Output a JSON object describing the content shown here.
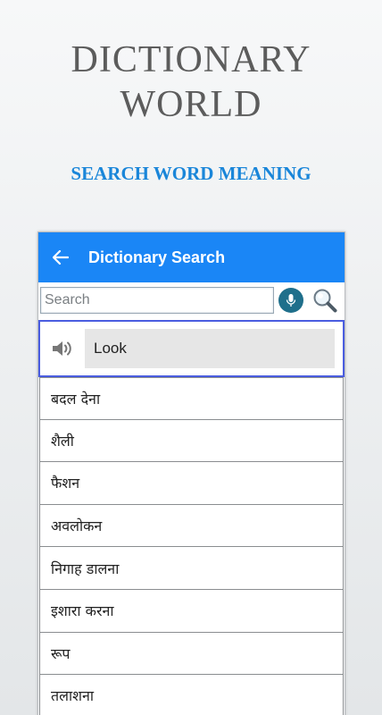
{
  "promo": {
    "title_line1": "DICTIONARY",
    "title_line2": "WORLD",
    "subtitle": "SEARCH WORD MEANING"
  },
  "appbar": {
    "back_icon": "arrow-left-icon",
    "title": "Dictionary Search",
    "color": "#1a86f6"
  },
  "search": {
    "placeholder": "Search",
    "value": "",
    "mic_icon": "microphone-icon",
    "search_icon": "magnifier-icon"
  },
  "result": {
    "speaker_icon": "speaker-icon",
    "word": "Look"
  },
  "meanings": [
    "बदल देना",
    "शैली",
    "फैशन",
    "अवलोकन",
    "निगाह डालना",
    "इशारा करना",
    "रूप",
    "तलाशना"
  ]
}
